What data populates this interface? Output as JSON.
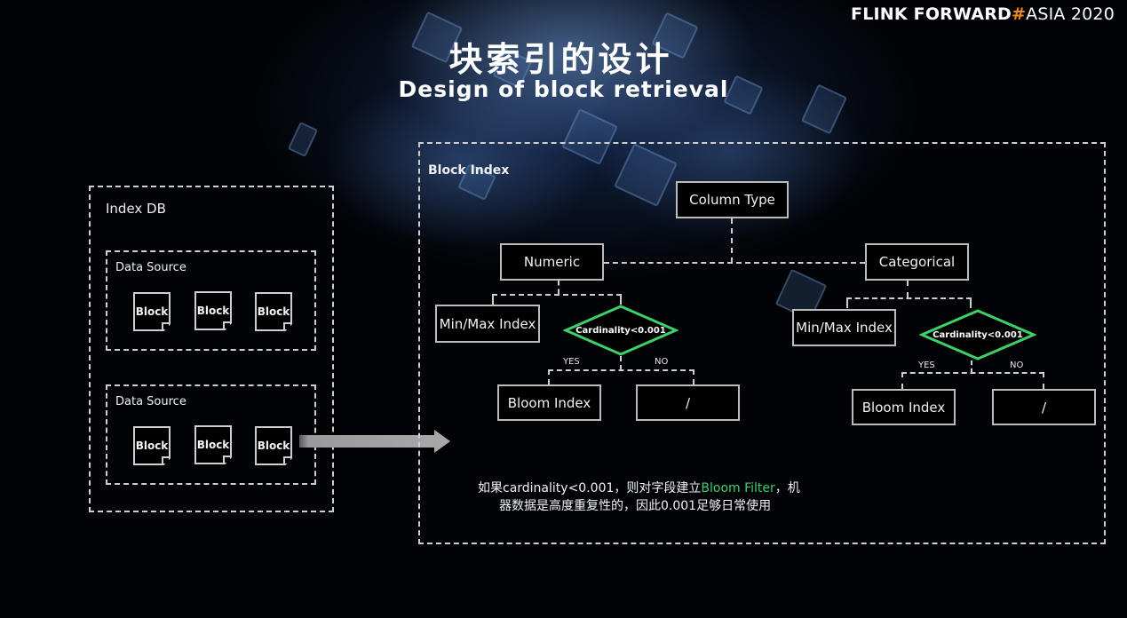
{
  "brand": {
    "part1": "FLINK FORWARD",
    "hash": "#",
    "part2": "ASIA 2020",
    "accent_color": "#f08a1c"
  },
  "title": {
    "cn": "块索引的设计",
    "en": "Design of block retrieval"
  },
  "index_db": {
    "label": "Index DB",
    "data_sources": [
      {
        "label": "Data Source",
        "blocks": [
          "Block",
          "Block",
          "Block"
        ]
      },
      {
        "label": "Data Source",
        "blocks": [
          "Block",
          "Block",
          "Block"
        ]
      }
    ]
  },
  "block_index": {
    "label": "Block Index",
    "root": "Column Type",
    "numeric": {
      "label": "Numeric",
      "minmax": "Min/Max Index",
      "decision": "Cardinality<0.001",
      "yes_label": "YES",
      "no_label": "NO",
      "yes_node": "Bloom Index",
      "no_node": "/"
    },
    "categorical": {
      "label": "Categorical",
      "minmax": "Min/Max Index",
      "decision": "Cardinality<0.001",
      "yes_label": "YES",
      "no_label": "NO",
      "yes_node": "Bloom Index",
      "no_node": "/"
    },
    "decision_color": "#3ecf6a"
  },
  "note": {
    "line1_pre": "如果cardinality<0.001，则对字段建立",
    "line1_highlight": "Bloom Filter",
    "line1_post": "，机",
    "line2": "器数据是高度重复性的，因此0.001足够日常使用"
  }
}
